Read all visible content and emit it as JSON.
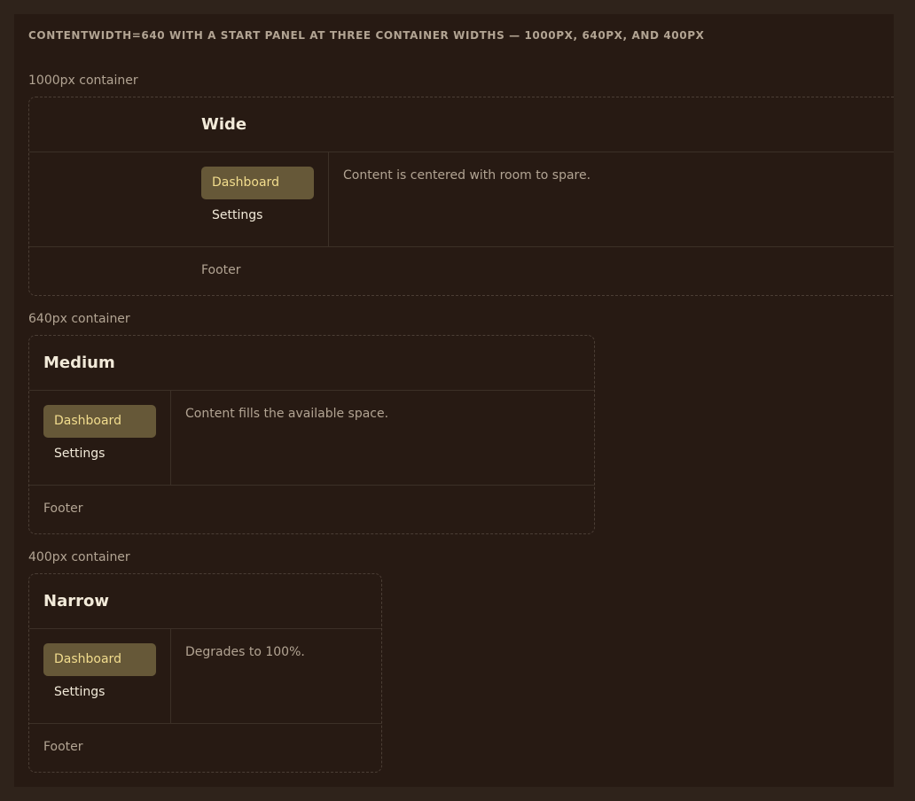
{
  "heading": "contentWidth=640 with a start panel at three container widths — 1000px, 640px, and 400px",
  "demos": [
    {
      "caption": "1000px container",
      "title": "Wide",
      "nav": [
        {
          "label": "Dashboard",
          "active": true
        },
        {
          "label": "Settings",
          "active": false
        }
      ],
      "content": "Content is centered with room to spare.",
      "footer": "Footer"
    },
    {
      "caption": "640px container",
      "title": "Medium",
      "nav": [
        {
          "label": "Dashboard",
          "active": true
        },
        {
          "label": "Settings",
          "active": false
        }
      ],
      "content": "Content fills the available space.",
      "footer": "Footer"
    },
    {
      "caption": "400px container",
      "title": "Narrow",
      "nav": [
        {
          "label": "Dashboard",
          "active": true
        },
        {
          "label": "Settings",
          "active": false
        }
      ],
      "content": "Degrades to 100%.",
      "footer": "Footer"
    }
  ]
}
